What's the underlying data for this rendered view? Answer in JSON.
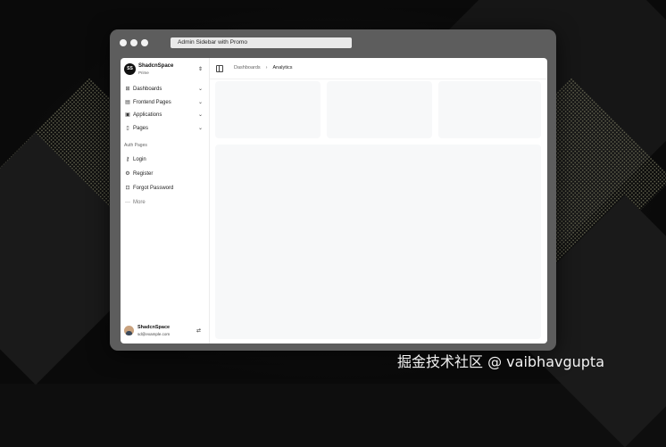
{
  "window": {
    "title": "Admin Sidebar with Promo"
  },
  "brand": {
    "name": "ShadcnSpace",
    "subtitle": "Prime",
    "logo_text": "SS"
  },
  "nav": [
    {
      "label": "Dashboards",
      "icon": "grid-icon"
    },
    {
      "label": "Frontend Pages",
      "icon": "file-icon"
    },
    {
      "label": "Applications",
      "icon": "shopping-bag-icon"
    },
    {
      "label": "Pages",
      "icon": "page-icon"
    }
  ],
  "auth": {
    "section_label": "Auth Pages",
    "items": [
      {
        "label": "Login",
        "icon": "key-icon"
      },
      {
        "label": "Register",
        "icon": "settings-icon"
      },
      {
        "label": "Forgot Password",
        "icon": "lock-icon"
      },
      {
        "label": "More",
        "icon": "more-icon"
      }
    ]
  },
  "user": {
    "name": "ShadcnSpace",
    "email": "sd@example.com"
  },
  "breadcrumb": {
    "parent": "Dashboards",
    "current": "Analytics"
  },
  "watermark": "掘金技术社区 @ vaibhavgupta"
}
